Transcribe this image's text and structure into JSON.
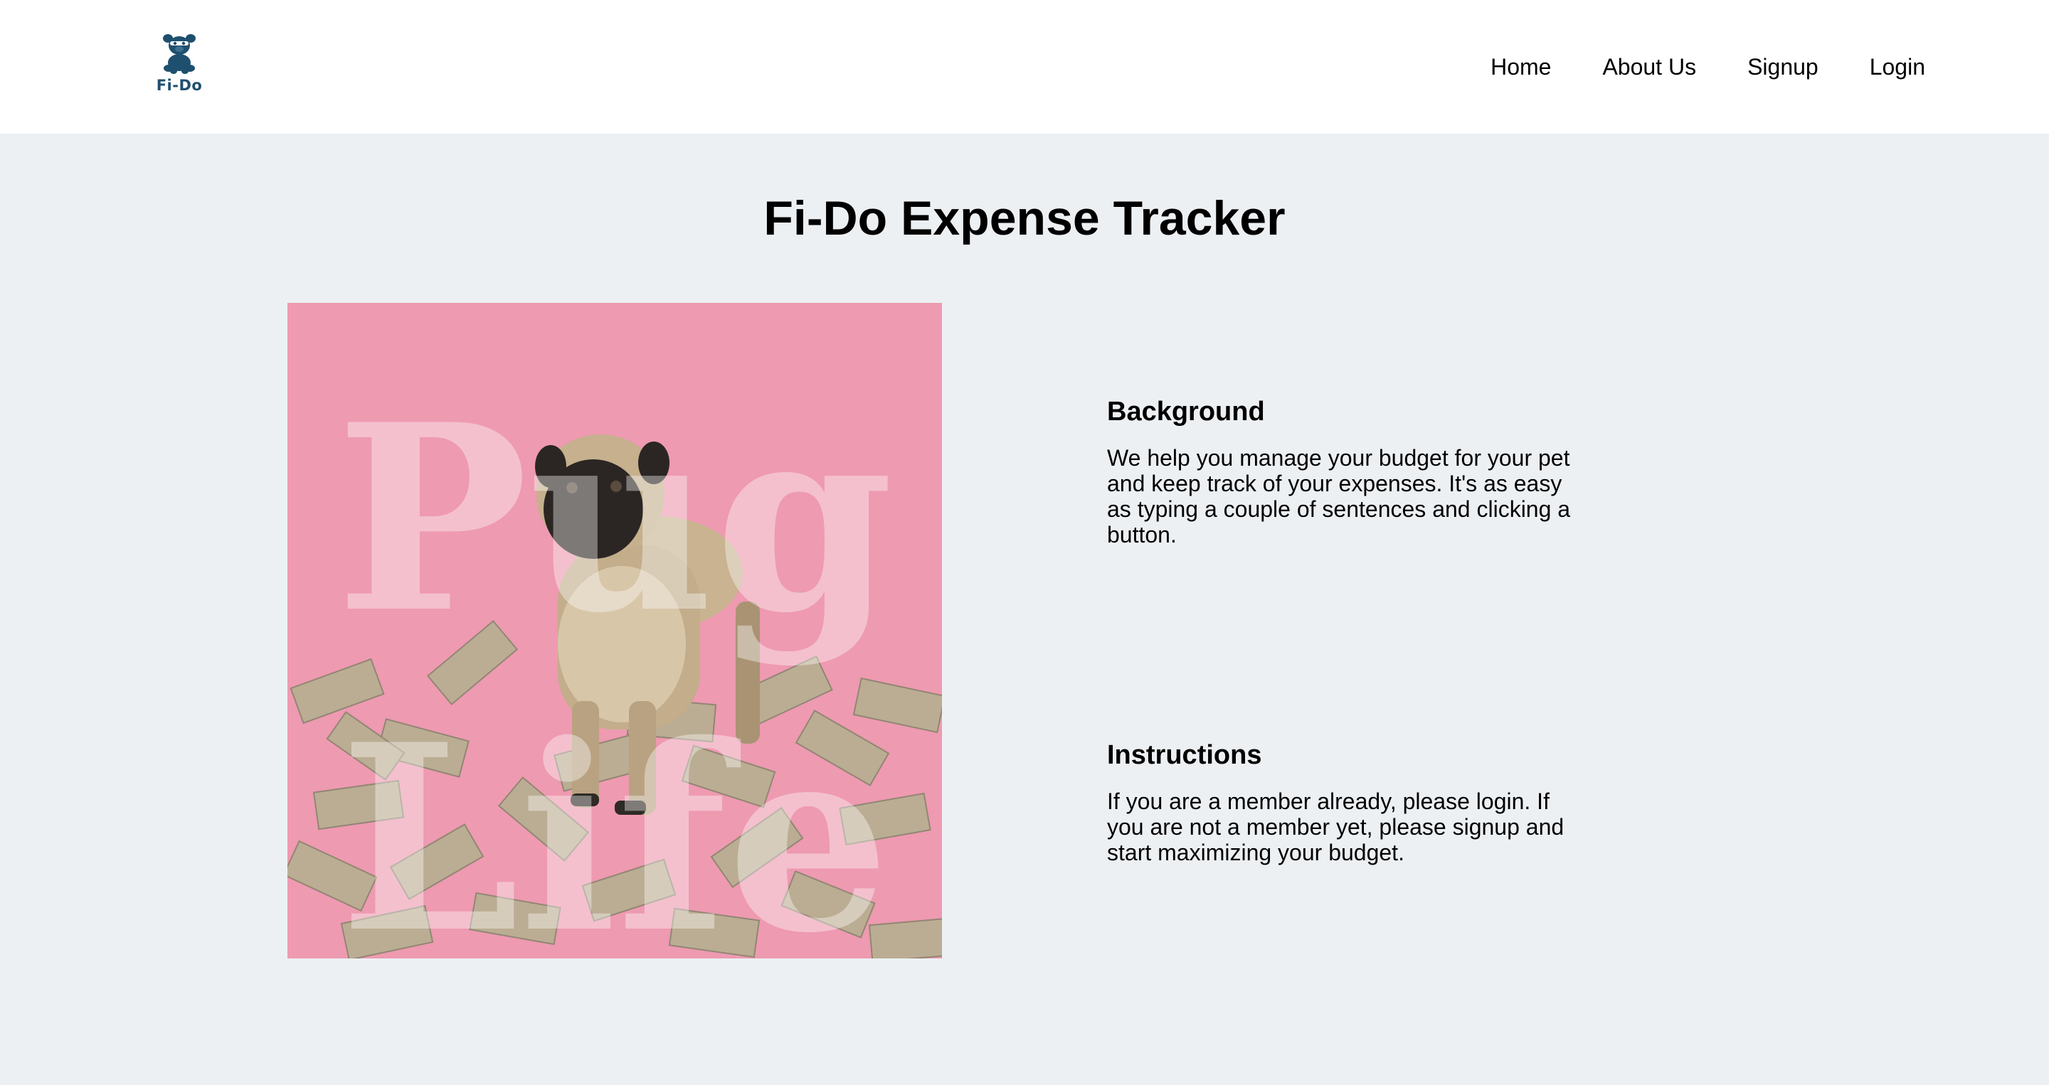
{
  "header": {
    "logo_text": "Fi-Do",
    "nav": [
      {
        "label": "Home"
      },
      {
        "label": "About Us"
      },
      {
        "label": "Signup"
      },
      {
        "label": "Login"
      }
    ]
  },
  "main": {
    "title": "Fi-Do Expense Tracker",
    "image": {
      "overlay_text_line1": "Pug",
      "overlay_text_line2": "Life"
    },
    "sections": [
      {
        "heading": "Background",
        "body": "We help you manage your budget for your pet and keep track of your expenses. It's as easy as typing a couple of sentences and clicking a button."
      },
      {
        "heading": "Instructions",
        "body": "If you are a member already, please login. If you are not a member yet, please signup and start maximizing your budget."
      }
    ]
  },
  "colors": {
    "page_bg": "#edf0f3",
    "header_bg": "#ffffff",
    "logo_color": "#1f4f6e",
    "image_pink": "#ee9ab1"
  },
  "icons": {
    "logo": "pug-mascot-icon"
  }
}
